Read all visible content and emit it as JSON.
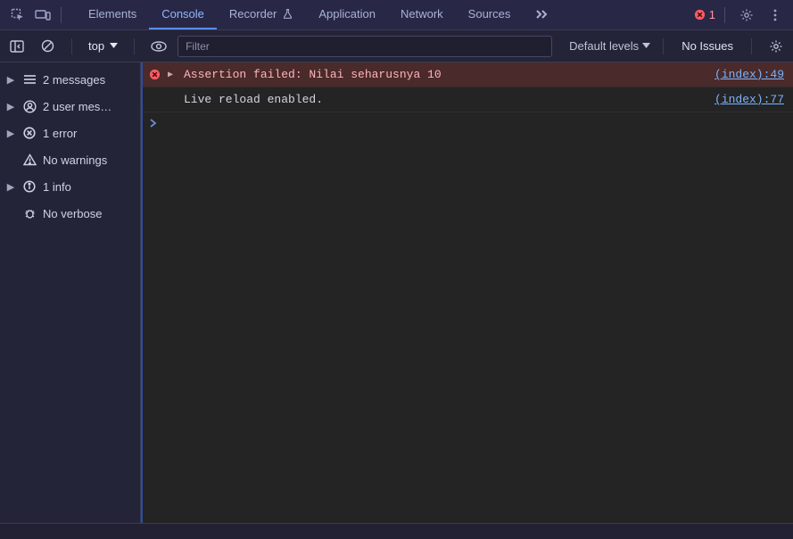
{
  "tabs": {
    "items": [
      "Elements",
      "Console",
      "Recorder",
      "Application",
      "Network",
      "Sources"
    ],
    "active_index": 1
  },
  "error_count": "1",
  "toolbar": {
    "context": "top",
    "filter_placeholder": "Filter",
    "levels_label": "Default levels",
    "issues_label": "No Issues"
  },
  "sidebar": {
    "items": [
      {
        "label": "2 messages",
        "icon": "list",
        "expandable": true
      },
      {
        "label": "2 user mes…",
        "icon": "user",
        "expandable": true
      },
      {
        "label": "1 error",
        "icon": "error",
        "expandable": true
      },
      {
        "label": "No warnings",
        "icon": "warning",
        "expandable": false
      },
      {
        "label": "1 info",
        "icon": "info",
        "expandable": true
      },
      {
        "label": "No verbose",
        "icon": "bug",
        "expandable": false
      }
    ]
  },
  "logs": [
    {
      "type": "error",
      "expandable": true,
      "message": "Assertion failed: Nilai seharusnya 10",
      "source": "(index):49"
    },
    {
      "type": "info",
      "expandable": false,
      "message": "Live reload enabled.",
      "source": "(index):77"
    }
  ]
}
